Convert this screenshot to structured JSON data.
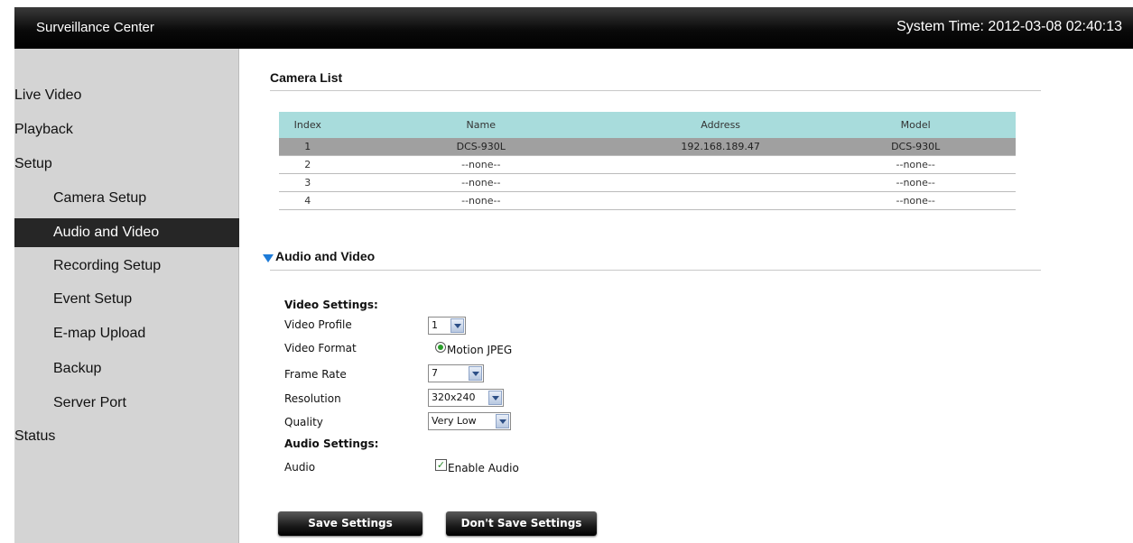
{
  "header": {
    "app_title": "Surveillance Center",
    "system_time": "System Time: 2012-03-08 02:40:13"
  },
  "sidebar": {
    "items": [
      {
        "label": "Live Video",
        "level": 1
      },
      {
        "label": "Playback",
        "level": 1
      },
      {
        "label": "Setup",
        "level": 1
      },
      {
        "label": "Camera Setup",
        "level": 2
      },
      {
        "label": "Audio and Video",
        "level": 2,
        "active": true
      },
      {
        "label": "Recording Setup",
        "level": 2
      },
      {
        "label": "Event Setup",
        "level": 2
      },
      {
        "label": "E-map Upload",
        "level": 2
      },
      {
        "label": "Backup",
        "level": 2
      },
      {
        "label": "Server Port",
        "level": 2
      },
      {
        "label": "Status",
        "level": 1
      }
    ]
  },
  "camera_list": {
    "title": "Camera List",
    "columns": [
      "Index",
      "Name",
      "Address",
      "Model"
    ],
    "rows": [
      [
        "1",
        "DCS-930L",
        "192.168.189.47",
        "DCS-930L"
      ],
      [
        "2",
        "--none--",
        "",
        "--none--"
      ],
      [
        "3",
        "--none--",
        "",
        "--none--"
      ],
      [
        "4",
        "--none--",
        "",
        "--none--"
      ]
    ],
    "selected_row": 0
  },
  "audio_video": {
    "title": "Audio and Video",
    "video_settings_heading": "Video Settings:",
    "video_profile_label": "Video Profile",
    "video_profile_value": "1",
    "video_format_label": "Video Format",
    "video_format_option": "Motion JPEG",
    "frame_rate_label": "Frame Rate",
    "frame_rate_value": "7",
    "resolution_label": "Resolution",
    "resolution_value": "320x240",
    "quality_label": "Quality",
    "quality_value": "Very Low",
    "audio_settings_heading": "Audio Settings:",
    "audio_label": "Audio",
    "enable_audio_label": "Enable Audio",
    "enable_audio_checked": true
  },
  "buttons": {
    "save": "Save Settings",
    "dont_save": "Don't Save Settings"
  },
  "colors": {
    "table_header": "#a8dcdc",
    "selected_row": "#a0a0a0",
    "active_nav": "#262626",
    "section_arrow": "#1e7bd8"
  },
  "icons": {
    "section_toggle": "triangle-down-icon",
    "dropdown": "chevron-down-icon",
    "radio": "radio-selected-icon",
    "checkbox": "checkbox-checked-icon"
  }
}
